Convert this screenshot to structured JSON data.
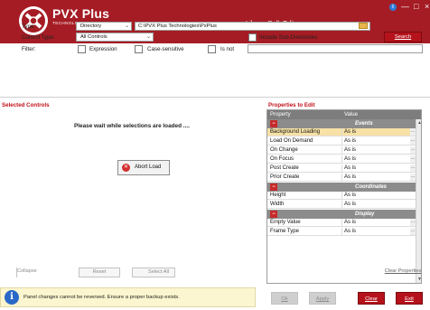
{
  "app": {
    "brand_name": "PVX Plus",
    "brand_sub": "TECHNOLOGIES LTD.",
    "window_title": "Library Bulk Edit",
    "brand_color": "#a51c24",
    "accent_red": "#b5121b"
  },
  "window_controls": {
    "minimize": "—",
    "maximize": "□",
    "close": "×"
  },
  "form": {
    "type_label": "Type:",
    "type_value": "Directory",
    "path_value": "C:\\PVX Plus Technologies\\PxPlus",
    "control_type_label": "Control Type:",
    "control_type_value": "All Controls",
    "include_subdirs_label": "Include Sub-Directories",
    "search_button": "Search",
    "filter_label": "Filter:",
    "expression_label": "Expression",
    "case_sensitive_label": "Case-sensitive",
    "is_not_label": "Is not",
    "filter_value": ""
  },
  "left_panel": {
    "title": "Selected Controls",
    "wait_message": "Please wait while selections are loaded  ....",
    "abort_button": "Abort Load",
    "collapse": "Collapse",
    "reset": "Reset",
    "select_all": "Select All"
  },
  "right_panel": {
    "title": "Properties to Edit",
    "col_property": "Property",
    "col_value": "Value",
    "groups": [
      {
        "name": "Events",
        "rows": [
          {
            "property": "Background Loading",
            "value": "As is",
            "selected": true
          },
          {
            "property": "Load On Demand",
            "value": "As is"
          },
          {
            "property": "On Change",
            "value": "As is"
          },
          {
            "property": "On Focus",
            "value": "As is"
          },
          {
            "property": "Post Create",
            "value": "As is"
          },
          {
            "property": "Prior Create",
            "value": "As is"
          }
        ]
      },
      {
        "name": "Coordinates",
        "rows": [
          {
            "property": "Height",
            "value": "As is"
          },
          {
            "property": "Width",
            "value": "As is"
          }
        ]
      },
      {
        "name": "Display",
        "rows": [
          {
            "property": "Empty Value",
            "value": "As is"
          },
          {
            "property": "Frame Type",
            "value": "As is"
          }
        ]
      }
    ],
    "clear_properties": "Clear Properties"
  },
  "footer": {
    "notice": "Panel changes cannot be reversed.  Ensure a proper backup exists.",
    "ok": "Ok",
    "apply": "Apply",
    "clear": "Clear",
    "exit": "Exit"
  }
}
